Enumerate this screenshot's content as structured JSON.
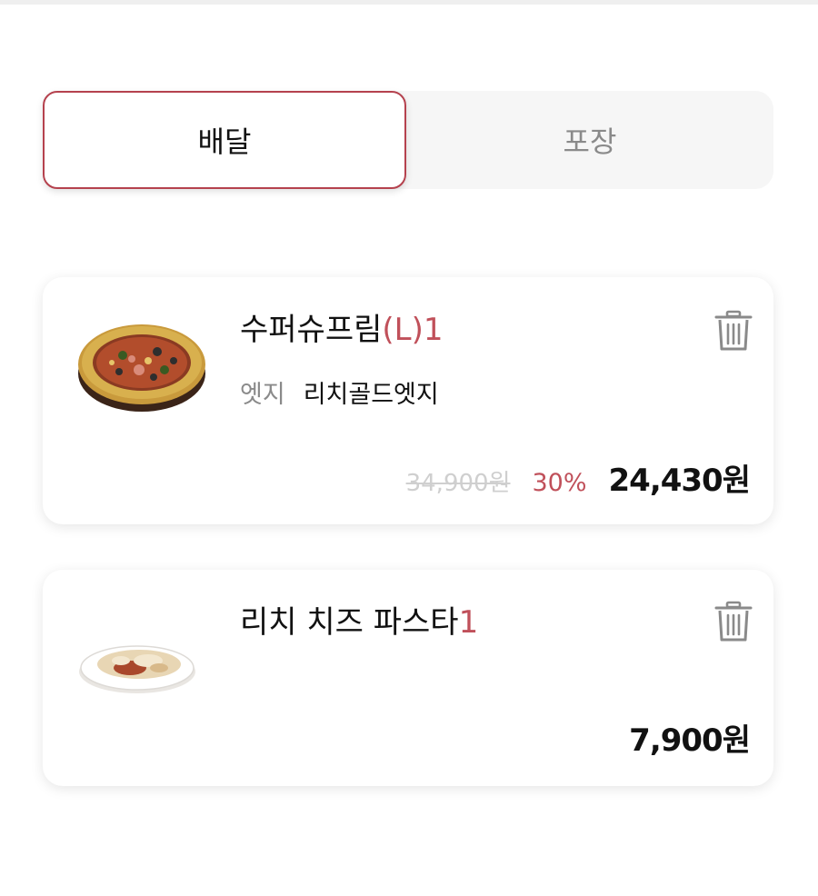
{
  "order_type": {
    "tabs": [
      {
        "label": "배달",
        "selected": true
      },
      {
        "label": "포장",
        "selected": false
      }
    ]
  },
  "cart": {
    "items": [
      {
        "name": "수퍼슈프림",
        "size": "(L)",
        "quantity": "1",
        "option_label": "엣지",
        "option_value": "리치골드엣지",
        "original_price": "34,900원",
        "discount": "30%",
        "price": "24,430원",
        "image_icon": "pizza-image",
        "delete_icon": "trash-icon"
      },
      {
        "name": "리치 치즈 파스타",
        "quantity": "1",
        "price": "7,900원",
        "image_icon": "pasta-image",
        "delete_icon": "trash-icon"
      }
    ]
  },
  "colors": {
    "accent": "#b5424e",
    "accent_text": "#c0505a",
    "muted": "#8a8a8a",
    "strike": "#cfcfcf"
  }
}
